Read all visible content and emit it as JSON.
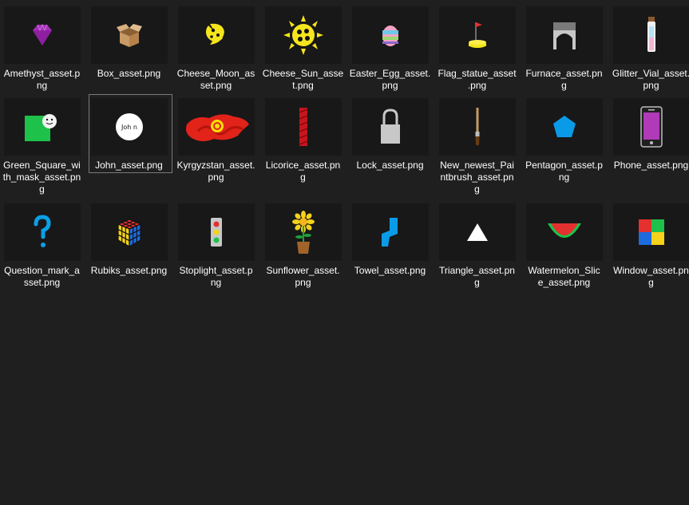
{
  "files": [
    {
      "name_lines": [
        "Amethyst_asset.p",
        "ng"
      ],
      "icon": "amethyst-icon"
    },
    {
      "name_lines": [
        "Box_asset.png"
      ],
      "icon": "box-icon"
    },
    {
      "name_lines": [
        "Cheese_Moon_as",
        "set.png"
      ],
      "icon": "cheese-moon-icon"
    },
    {
      "name_lines": [
        "Cheese_Sun_asse",
        "t.png"
      ],
      "icon": "cheese-sun-icon"
    },
    {
      "name_lines": [
        "Easter_Egg_asset.",
        "png"
      ],
      "icon": "easter-egg-icon"
    },
    {
      "name_lines": [
        "Flag_statue_asset",
        ".png"
      ],
      "icon": "flag-statue-icon"
    },
    {
      "name_lines": [
        "Furnace_asset.pn",
        "g"
      ],
      "icon": "furnace-icon"
    },
    {
      "name_lines": [
        "Glitter_Vial_asset.",
        "png"
      ],
      "icon": "glitter-vial-icon"
    },
    {
      "name_lines": [
        "Green_Square_wi",
        "th_mask_asset.pn",
        "g"
      ],
      "icon": "green-square-mask-icon"
    },
    {
      "name_lines": [
        "John_asset.png"
      ],
      "icon": "john-icon",
      "thumb_text": "Joh n",
      "selected": true
    },
    {
      "name_lines": [
        "Kyrgyzstan_asset.",
        "png"
      ],
      "icon": "kyrgyzstan-flag-icon"
    },
    {
      "name_lines": [
        "Licorice_asset.pn",
        "g"
      ],
      "icon": "licorice-icon"
    },
    {
      "name_lines": [
        "Lock_asset.png"
      ],
      "icon": "lock-icon"
    },
    {
      "name_lines": [
        "New_newest_Pai",
        "ntbrush_asset.pn",
        "g"
      ],
      "icon": "paintbrush-icon"
    },
    {
      "name_lines": [
        "Pentagon_asset.p",
        "ng"
      ],
      "icon": "pentagon-icon"
    },
    {
      "name_lines": [
        "Phone_asset.png"
      ],
      "icon": "phone-icon"
    },
    {
      "name_lines": [
        "Question_mark_a",
        "sset.png"
      ],
      "icon": "question-mark-icon"
    },
    {
      "name_lines": [
        "Rubiks_asset.png"
      ],
      "icon": "rubiks-cube-icon"
    },
    {
      "name_lines": [
        "Stoplight_asset.p",
        "ng"
      ],
      "icon": "stoplight-icon"
    },
    {
      "name_lines": [
        "Sunflower_asset.",
        "png"
      ],
      "icon": "sunflower-icon"
    },
    {
      "name_lines": [
        "Towel_asset.png"
      ],
      "icon": "towel-icon"
    },
    {
      "name_lines": [
        "Triangle_asset.pn",
        "g"
      ],
      "icon": "triangle-icon"
    },
    {
      "name_lines": [
        "Watermelon_Slic",
        "e_asset.png"
      ],
      "icon": "watermelon-slice-icon"
    },
    {
      "name_lines": [
        "Window_asset.pn",
        "g"
      ],
      "icon": "window-icon"
    }
  ],
  "colors": {
    "background": "#1f1f1f",
    "thumb_background": "#181818",
    "selection_border": "#7a7a7a"
  }
}
